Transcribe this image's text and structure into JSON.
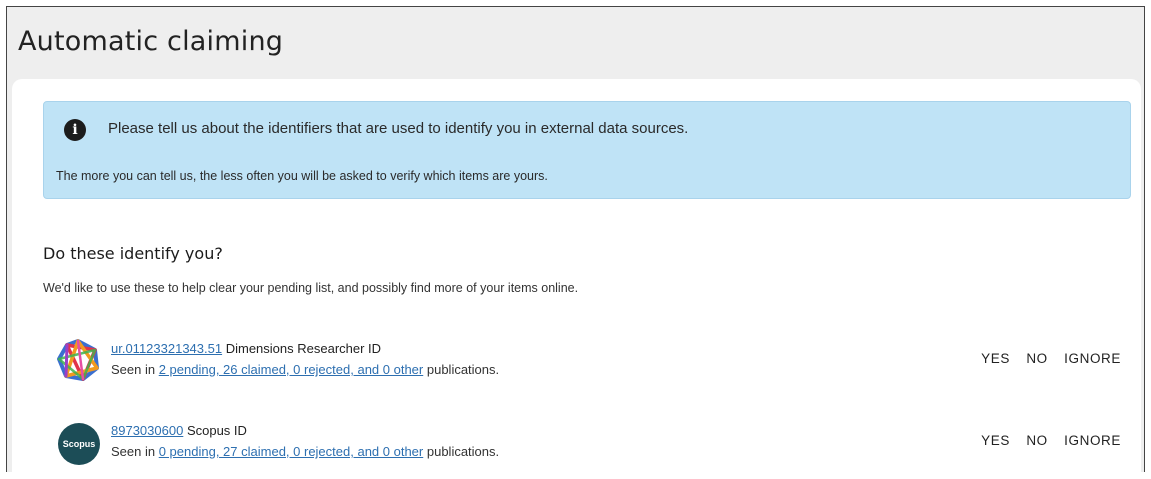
{
  "page": {
    "title": "Automatic claiming"
  },
  "info": {
    "icon": "info-icon",
    "icon_glyph": "i",
    "main_text": "Please tell us about the identifiers that are used to identify you in external data sources.",
    "sub_text": "The more you can tell us, the less often you will be asked to verify which items are yours."
  },
  "section": {
    "title": "Do these identify you?",
    "description": "We'd like to use these to help clear your pending list, and possibly find more of your items online."
  },
  "identifiers": [
    {
      "logo": "dimensions-logo",
      "id_value": "ur.01123321343.51",
      "id_type": "Dimensions Researcher ID",
      "seen_prefix": "Seen in",
      "seen_link": "2 pending, 26 claimed, 0 rejected, and 0 other",
      "seen_suffix": "publications.",
      "yes": "YES",
      "no": "NO",
      "ignore": "IGNORE"
    },
    {
      "logo": "scopus-logo",
      "logo_text": "Scopus",
      "id_value": "8973030600",
      "id_type": "Scopus ID",
      "seen_prefix": "Seen in",
      "seen_link": "0 pending, 27 claimed, 0 rejected, and 0 other",
      "seen_suffix": "publications.",
      "yes": "YES",
      "no": "NO",
      "ignore": "IGNORE"
    }
  ],
  "colors": {
    "info_background": "#bfe3f6",
    "link": "#2d6fb0",
    "scopus_logo": "#1c4d57"
  }
}
